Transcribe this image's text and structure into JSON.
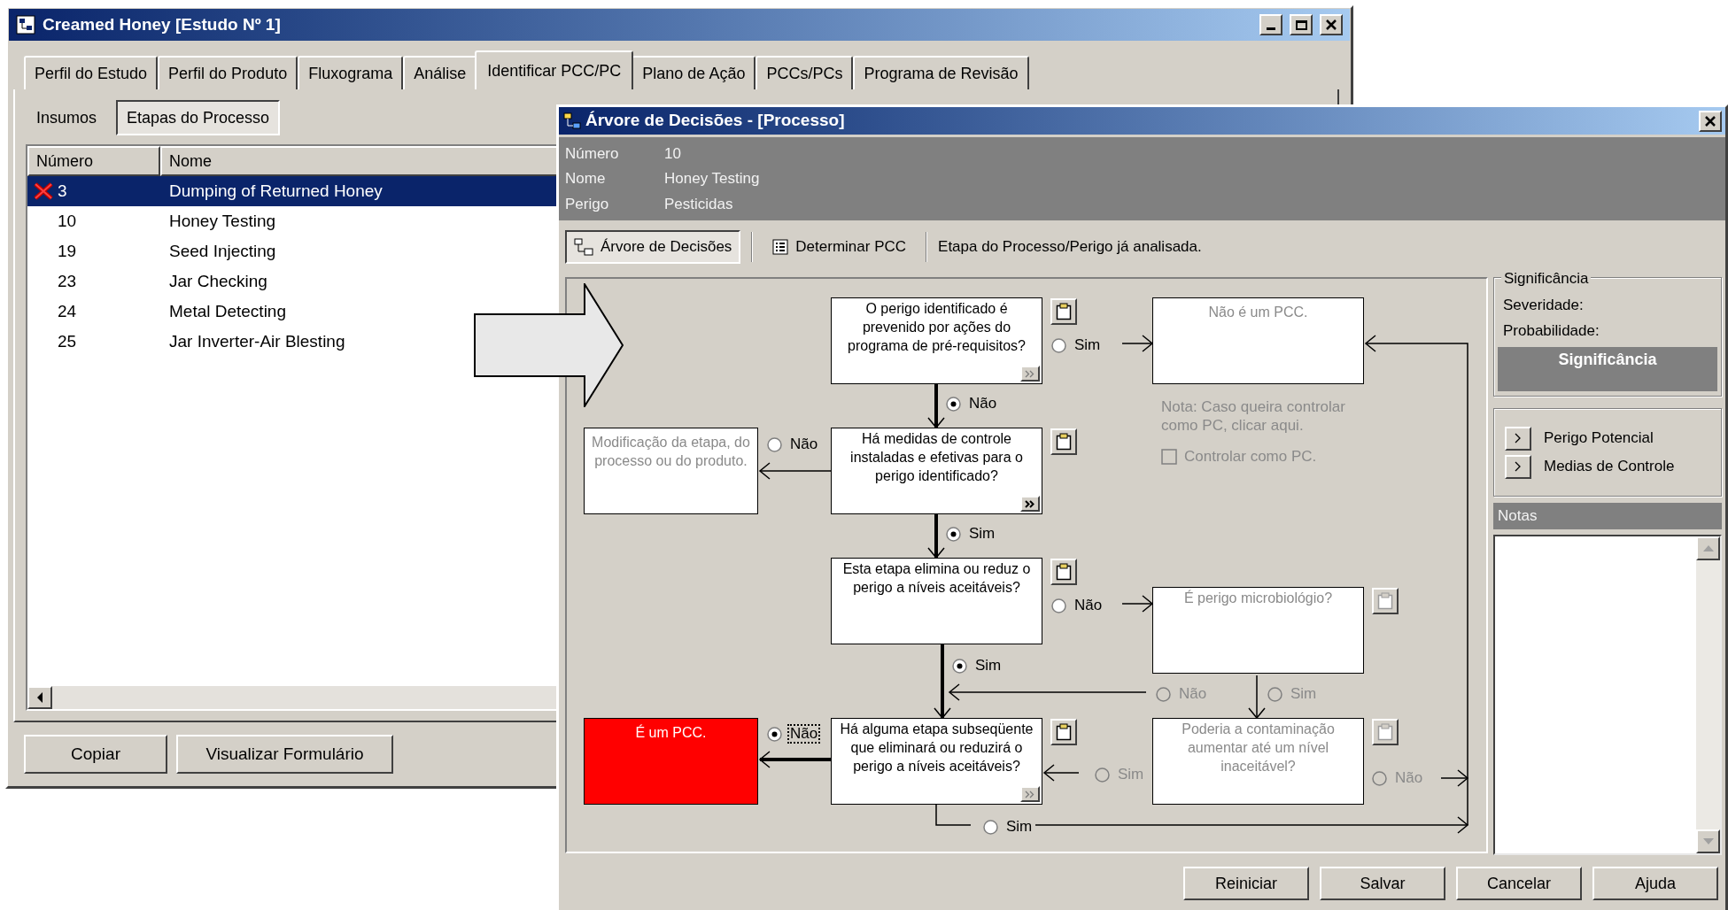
{
  "main_window": {
    "title": "Creamed Honey [Estudo Nº 1]"
  },
  "tabs": [
    {
      "label": "Perfil do Estudo",
      "selected": false
    },
    {
      "label": "Perfil do Produto",
      "selected": false
    },
    {
      "label": "Fluxograma",
      "selected": false
    },
    {
      "label": "Análise",
      "selected": false
    },
    {
      "label": "Identificar PCC/PC",
      "selected": true
    },
    {
      "label": "Plano de Ação",
      "selected": false
    },
    {
      "label": "PCCs/PCs",
      "selected": false
    },
    {
      "label": "Programa de Revisão",
      "selected": false
    }
  ],
  "subtabs": [
    {
      "label": "Insumos",
      "selected": false
    },
    {
      "label": "Etapas do Processo",
      "selected": true
    }
  ],
  "steps_table": {
    "columns": [
      "Número",
      "Nome"
    ],
    "rows": [
      {
        "number": "3",
        "name": "Dumping of Returned Honey",
        "selected": true,
        "marked": true
      },
      {
        "number": "10",
        "name": "Honey Testing",
        "selected": false,
        "marked": false
      },
      {
        "number": "19",
        "name": "Seed Injecting",
        "selected": false,
        "marked": false
      },
      {
        "number": "23",
        "name": "Jar Checking",
        "selected": false,
        "marked": false
      },
      {
        "number": "24",
        "name": "Metal Detecting",
        "selected": false,
        "marked": false
      },
      {
        "number": "25",
        "name": "Jar Inverter-Air Blesting",
        "selected": false,
        "marked": false
      }
    ]
  },
  "main_buttons": [
    "Copiar",
    "Visualizar Formulário"
  ],
  "dialog": {
    "title": "Árvore de Decisões - [Processo]",
    "fields": [
      {
        "label": "Número",
        "value": "10"
      },
      {
        "label": "Nome",
        "value": "Honey Testing"
      },
      {
        "label": "Perigo",
        "value": "Pesticidas"
      }
    ],
    "toolbar": [
      {
        "label": "Árvore de Decisões",
        "selected": true
      },
      {
        "label": "Determinar PCC",
        "selected": false
      }
    ],
    "status": "Etapa do Processo/Perigo já analisada.",
    "diagram": {
      "boxes": [
        {
          "kind": "question",
          "text": "O perigo identificado é prevenido por ações do programa de pré-requisitos?",
          "disabled": false,
          "notes_button": {
            "disabled": false
          },
          "more_button": {
            "disabled": true
          }
        },
        {
          "kind": "result",
          "text": "Não é um PCC.",
          "disabled": true,
          "highlighted": false
        },
        {
          "kind": "result",
          "text": "Modificação da etapa, do processo ou do produto.",
          "disabled": true,
          "highlighted": false
        },
        {
          "kind": "question",
          "text": "Há medidas de controle instaladas e efetivas para o perigo identificado?",
          "disabled": false,
          "notes_button": {
            "disabled": false
          },
          "more_button": {
            "disabled": false
          }
        },
        {
          "kind": "question",
          "text": "Esta etapa elimina ou reduz o perigo a níveis aceitáveis?",
          "disabled": false,
          "notes_button": {
            "disabled": false
          }
        },
        {
          "kind": "question",
          "text": "É perigo microbiológio?",
          "disabled": true,
          "notes_button": {
            "disabled": true
          }
        },
        {
          "kind": "result",
          "text": "É um PCC.",
          "disabled": false,
          "highlighted": true
        },
        {
          "kind": "question",
          "text": "Há alguma etapa subseqüente que eliminará ou reduzirá o perigo a níveis aceitáveis?",
          "disabled": false,
          "notes_button": {
            "disabled": false
          },
          "more_button": {
            "disabled": true
          }
        },
        {
          "kind": "question",
          "text": "Poderia a contaminação aumentar até um nível inaceitável?",
          "disabled": true,
          "notes_button": {
            "disabled": true
          }
        }
      ],
      "options": [
        {
          "label": "Sim",
          "selected": false,
          "disabled": false,
          "focused": false
        },
        {
          "label": "Não",
          "selected": true,
          "disabled": false,
          "focused": false
        },
        {
          "label": "Não",
          "selected": false,
          "disabled": false,
          "focused": false
        },
        {
          "label": "Sim",
          "selected": true,
          "disabled": false,
          "focused": false
        },
        {
          "label": "Não",
          "selected": false,
          "disabled": false,
          "focused": false
        },
        {
          "label": "Sim",
          "selected": true,
          "disabled": false,
          "focused": false
        },
        {
          "label": "Não",
          "selected": false,
          "disabled": true,
          "focused": false
        },
        {
          "label": "Sim",
          "selected": false,
          "disabled": true,
          "focused": false
        },
        {
          "label": "Não",
          "selected": true,
          "disabled": false,
          "focused": true
        },
        {
          "label": "Sim",
          "selected": false,
          "disabled": true,
          "focused": false
        },
        {
          "label": "Não",
          "selected": false,
          "disabled": true,
          "focused": false
        },
        {
          "label": "Sim",
          "selected": false,
          "disabled": false,
          "focused": false
        }
      ],
      "note": "Nota: Caso queira controlar como PC, clicar aqui.",
      "control_checkbox": {
        "label": "Controlar como PC.",
        "checked": false,
        "disabled": true
      }
    },
    "significance": {
      "title": "Significância",
      "fields": [
        "Severidade:",
        "Probabilidade:"
      ],
      "result": "Significância"
    },
    "links": [
      "Perigo Potencial",
      "Medias de Controle"
    ],
    "notes": {
      "title": "Notas"
    },
    "buttons": [
      "Reiniciar",
      "Salvar",
      "Cancelar",
      "Ajuda"
    ]
  }
}
